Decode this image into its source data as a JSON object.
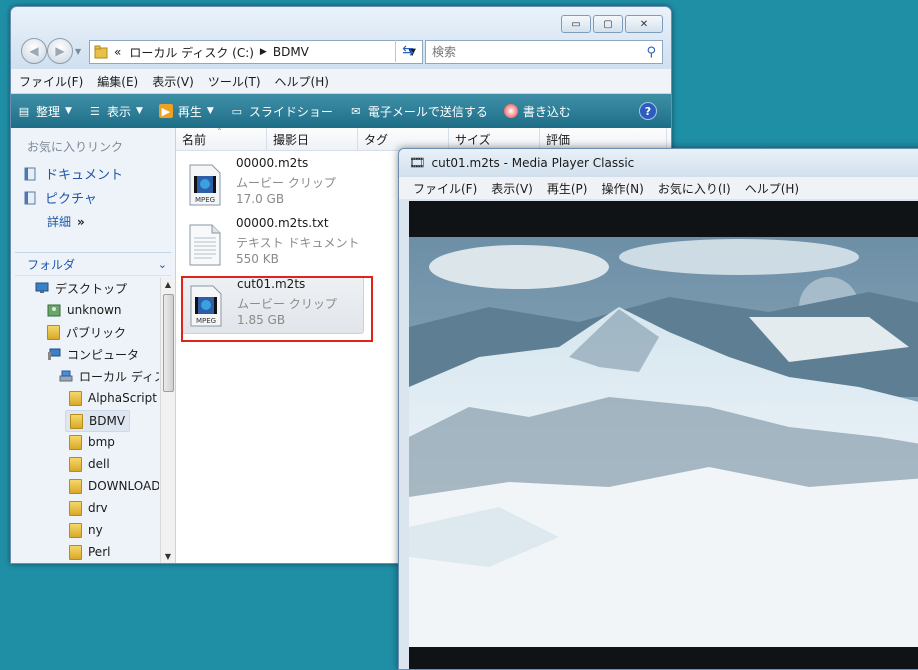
{
  "explorer": {
    "window_controls": {
      "minimize": "▭",
      "maximize": "▢",
      "close": "✕"
    },
    "address": {
      "prefix": "«",
      "segments": [
        "ローカル ディスク (C:)",
        "BDMV"
      ]
    },
    "search_placeholder": "検索",
    "menu": [
      "ファイル(F)",
      "編集(E)",
      "表示(V)",
      "ツール(T)",
      "ヘルプ(H)"
    ],
    "toolbar": [
      {
        "label": "整理",
        "has_arrow": true,
        "icon": "organize-icon"
      },
      {
        "label": "表示",
        "has_arrow": true,
        "icon": "views-icon"
      },
      {
        "label": "再生",
        "has_arrow": true,
        "icon": "play-icon"
      },
      {
        "label": "スライドショー",
        "has_arrow": false,
        "icon": "slideshow-icon"
      },
      {
        "label": "電子メールで送信する",
        "has_arrow": false,
        "icon": "email-icon"
      },
      {
        "label": "書き込む",
        "has_arrow": false,
        "icon": "burn-icon"
      }
    ],
    "favorites_header": "お気に入りリンク",
    "favorites": [
      "ドキュメント",
      "ピクチャ"
    ],
    "more_label": "詳細",
    "more_chevron": "»",
    "folders_header": "フォルダ",
    "tree": [
      {
        "label": "デスクトップ",
        "indent": 0,
        "icon": "desktop-icon"
      },
      {
        "label": "unknown",
        "indent": 1,
        "icon": "user-folder-icon"
      },
      {
        "label": "パブリック",
        "indent": 1,
        "icon": "folder-icon"
      },
      {
        "label": "コンピュータ",
        "indent": 1,
        "icon": "computer-icon"
      },
      {
        "label": "ローカル ディスク (C:)",
        "indent": 2,
        "icon": "drive-icon"
      },
      {
        "label": "AlphaScript",
        "indent": 3,
        "icon": "folder-icon"
      },
      {
        "label": "BDMV",
        "indent": 3,
        "icon": "folder-icon",
        "selected": true
      },
      {
        "label": "bmp",
        "indent": 3,
        "icon": "folder-icon"
      },
      {
        "label": "dell",
        "indent": 3,
        "icon": "folder-icon"
      },
      {
        "label": "DOWNLOAD",
        "indent": 3,
        "icon": "folder-icon"
      },
      {
        "label": "drv",
        "indent": 3,
        "icon": "folder-icon"
      },
      {
        "label": "ny",
        "indent": 3,
        "icon": "folder-icon"
      },
      {
        "label": "Perl",
        "indent": 3,
        "icon": "folder-icon"
      }
    ],
    "columns": [
      "名前",
      "撮影日",
      "タグ",
      "サイズ",
      "評価"
    ],
    "files": [
      {
        "name": "00000.m2ts",
        "type": "ムービー クリップ",
        "size": "17.0 GB",
        "icon": "mpeg-file-icon",
        "badge": "MPEG"
      },
      {
        "name": "00000.m2ts.txt",
        "type": "テキスト ドキュメント",
        "size": "550 KB",
        "icon": "text-file-icon"
      },
      {
        "name": "cut01.m2ts",
        "type": "ムービー クリップ",
        "size": "1.85 GB",
        "icon": "mpeg-file-icon",
        "badge": "MPEG",
        "selected": true
      }
    ],
    "highlight_color": "#e0241c"
  },
  "mpc": {
    "title": "cut01.m2ts - Media Player Classic",
    "menu": [
      "ファイル(F)",
      "表示(V)",
      "再生(P)",
      "操作(N)",
      "お気に入り(I)",
      "ヘルプ(H)"
    ]
  },
  "colors": {
    "desktop": "#1f8fa6",
    "toolbar": "#2a7f98",
    "link": "#1f56a8"
  }
}
